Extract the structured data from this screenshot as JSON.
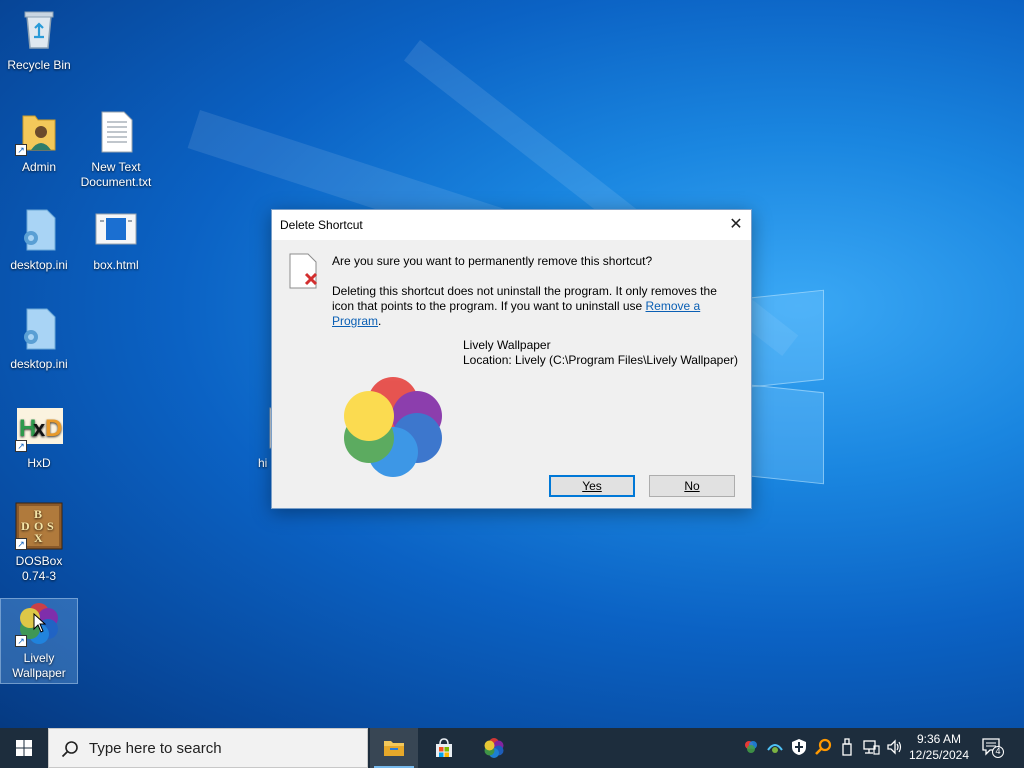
{
  "desktop": {
    "icons": [
      {
        "label": "Recycle Bin"
      },
      {
        "label": "Admin"
      },
      {
        "label": "New Text Document.txt"
      },
      {
        "label": "desktop.ini"
      },
      {
        "label": "box.html"
      },
      {
        "label": "desktop.ini"
      },
      {
        "label": "HxD"
      },
      {
        "label": "hi"
      },
      {
        "label": "DOSBox 0.74-3"
      },
      {
        "label": "Lively Wallpaper"
      }
    ]
  },
  "dialog": {
    "title": "Delete Shortcut",
    "close_glyph": "✕",
    "question": "Are you sure you want to permanently remove this shortcut?",
    "description": "Deleting this shortcut does not uninstall the program. It only removes the icon that points to the program. If you want to uninstall use ",
    "link_text": "Remove a Program",
    "description_end": ".",
    "program_name": "Lively Wallpaper",
    "program_location": "Location: Lively (C:\\Program Files\\Lively Wallpaper)",
    "yes_label": "Yes",
    "no_label": "No"
  },
  "taskbar": {
    "search_placeholder": "Type here to search",
    "clock_time": "9:36 AM",
    "clock_date": "12/25/2024",
    "notification_count": "4"
  },
  "colors": {
    "accent": "#0078d7",
    "taskbar": "#1d2d3d",
    "link": "#0a5fb4"
  }
}
